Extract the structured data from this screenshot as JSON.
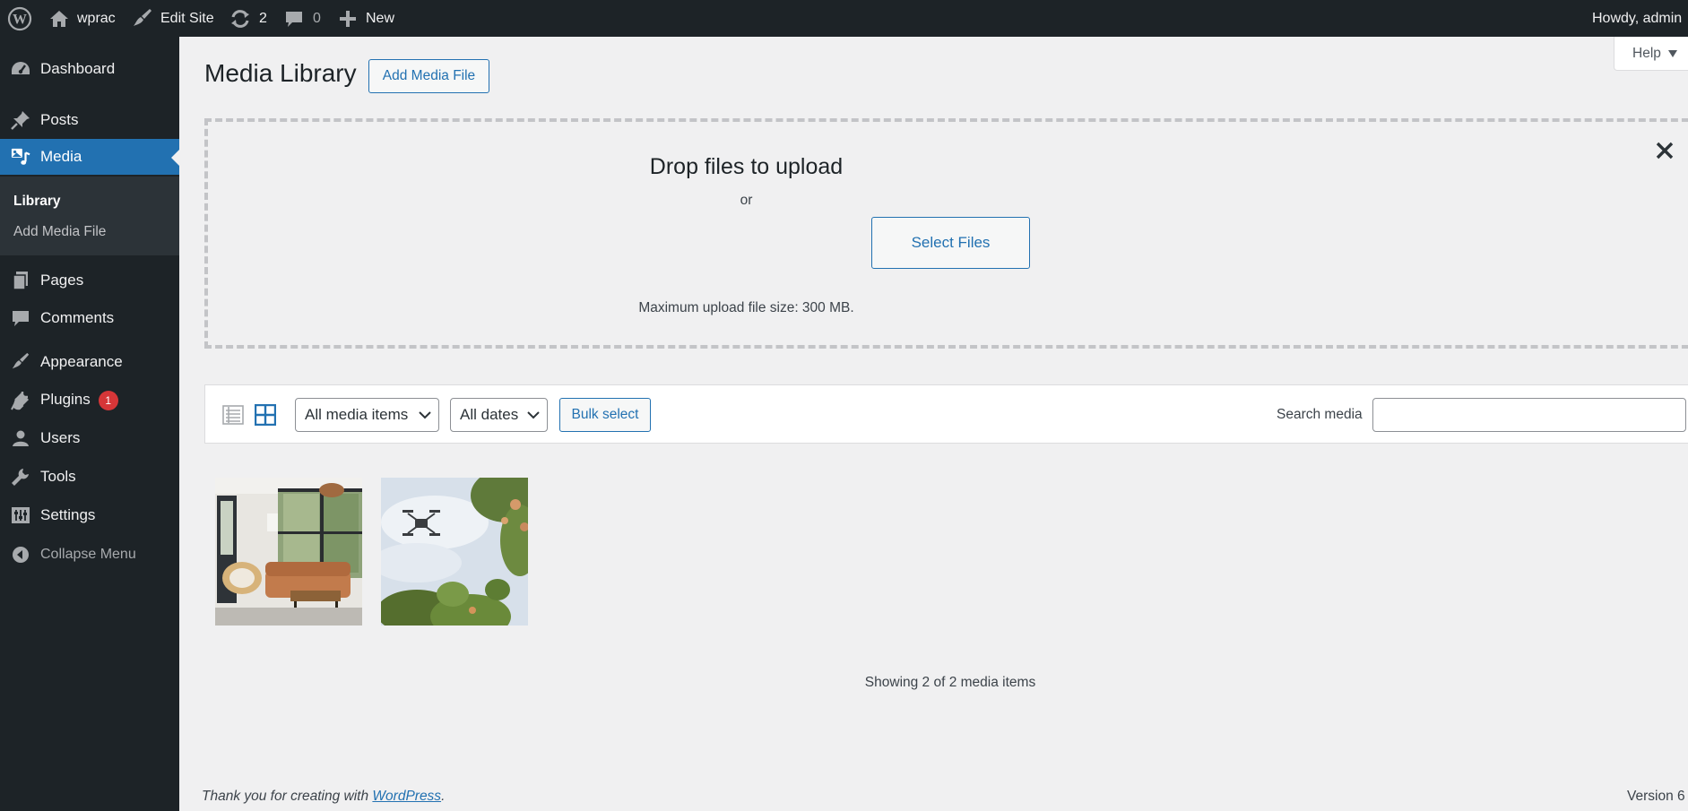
{
  "adminbar": {
    "site_name": "wprac",
    "edit_site": "Edit Site",
    "updates_count": "2",
    "comments_count": "0",
    "new_label": "New",
    "howdy": "Howdy, admin"
  },
  "sidebar": {
    "items": [
      {
        "label": "Dashboard",
        "icon": "dashboard-icon"
      },
      {
        "label": "Posts",
        "icon": "pin-icon"
      },
      {
        "label": "Media",
        "icon": "media-icon"
      },
      {
        "label": "Pages",
        "icon": "pages-icon"
      },
      {
        "label": "Comments",
        "icon": "comment-icon"
      },
      {
        "label": "Appearance",
        "icon": "brush-icon"
      },
      {
        "label": "Plugins",
        "icon": "plugin-icon",
        "badge": "1"
      },
      {
        "label": "Users",
        "icon": "user-icon"
      },
      {
        "label": "Tools",
        "icon": "wrench-icon"
      },
      {
        "label": "Settings",
        "icon": "settings-icon"
      }
    ],
    "submenu": [
      {
        "label": "Library"
      },
      {
        "label": "Add Media File"
      }
    ],
    "collapse": "Collapse Menu"
  },
  "main": {
    "title": "Media Library",
    "add_button": "Add Media File",
    "help": "Help"
  },
  "upload": {
    "title": "Drop files to upload",
    "or": "or",
    "select_button": "Select Files",
    "max_size": "Maximum upload file size: 300 MB."
  },
  "toolbar": {
    "filter_type": "All media items",
    "filter_date": "All dates",
    "bulk_select": "Bulk select",
    "search_label": "Search media",
    "search_value": ""
  },
  "media": {
    "items": [
      {
        "icon": "living-room-photo"
      },
      {
        "icon": "drone-photo"
      }
    ],
    "showing": "Showing 2 of 2 media items"
  },
  "footer": {
    "thanks_prefix": "Thank you for creating with",
    "link": "WordPress",
    "thanks_suffix": ".",
    "version": "Version 6"
  },
  "colors": {
    "admin_dark": "#1d2327",
    "accent": "#2271b1",
    "badge": "#d63638",
    "background": "#f0f0f1"
  }
}
